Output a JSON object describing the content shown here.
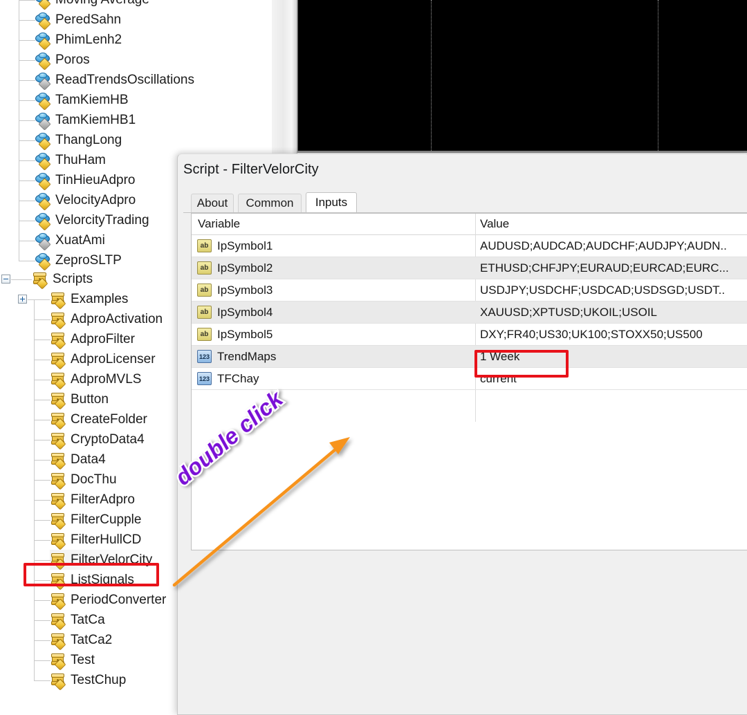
{
  "navigator": {
    "indicators": [
      "Moving Average",
      "PeredSahn",
      "PhimLenh2",
      "Poros",
      "ReadTrendsOscillations",
      "TamKiemHB",
      "TamKiemHB1",
      "ThangLong",
      "ThuHam",
      "TinHieuAdpro",
      "VelocityAdpro",
      "VelorcityTrading",
      "XuatAmi",
      "ZeproSLTP"
    ],
    "indicator_grey_flags": [
      false,
      false,
      false,
      false,
      true,
      false,
      true,
      false,
      false,
      false,
      false,
      false,
      true,
      false
    ],
    "scripts_root_label": "Scripts",
    "scripts_folder_label": "Examples",
    "scripts": [
      "AdproActivation",
      "AdproFilter",
      "AdproLicenser",
      "AdproMVLS",
      "Button",
      "CreateFolder",
      "CryptoData4",
      "Data4",
      "DocThu",
      "FilterAdpro",
      "FilterCupple",
      "FilterHullCD",
      "FilterVelorCity",
      "ListSignals",
      "PeriodConverter",
      "TatCa",
      "TatCa2",
      "Test",
      "TestChup"
    ],
    "selected_script": "FilterVelorCity"
  },
  "dialog": {
    "title": "Script - FilterVelorCity",
    "tabs": [
      {
        "label": "About",
        "selected": false
      },
      {
        "label": "Common",
        "selected": false
      },
      {
        "label": "Inputs",
        "selected": true
      }
    ],
    "table": {
      "headers": {
        "variable": "Variable",
        "value": "Value"
      },
      "rows": [
        {
          "icon": "string-type-icon",
          "icon_glyph": "ab",
          "variable": "IpSymbol1",
          "value": "AUDUSD;AUDCAD;AUDCHF;AUDJPY;AUDN.."
        },
        {
          "icon": "string-type-icon",
          "icon_glyph": "ab",
          "variable": "IpSymbol2",
          "value": "ETHUSD;CHFJPY;EURAUD;EURCAD;EURC..."
        },
        {
          "icon": "string-type-icon",
          "icon_glyph": "ab",
          "variable": "IpSymbol3",
          "value": "USDJPY;USDCHF;USDCAD;USDSGD;USDT.."
        },
        {
          "icon": "string-type-icon",
          "icon_glyph": "ab",
          "variable": "IpSymbol4",
          "value": "XAUUSD;XPTUSD;UKOIL;USOIL"
        },
        {
          "icon": "string-type-icon",
          "icon_glyph": "ab",
          "variable": "IpSymbol5",
          "value": "DXY;FR40;US30;UK100;STOXX50;US500"
        },
        {
          "icon": "number-type-icon",
          "icon_glyph": "123",
          "variable": "TrendMaps",
          "value": "1 Week"
        },
        {
          "icon": "number-type-icon",
          "icon_glyph": "123",
          "variable": "TFChay",
          "value": "current"
        }
      ]
    }
  },
  "annotations": {
    "double_click_label": "double click",
    "highlight_color": "#e8121a",
    "arrow_color": "#f7931e",
    "label_color": "#7a10d6"
  },
  "chart": {
    "background_color": "#000000",
    "gridline_positions": [
      192,
      520
    ]
  }
}
